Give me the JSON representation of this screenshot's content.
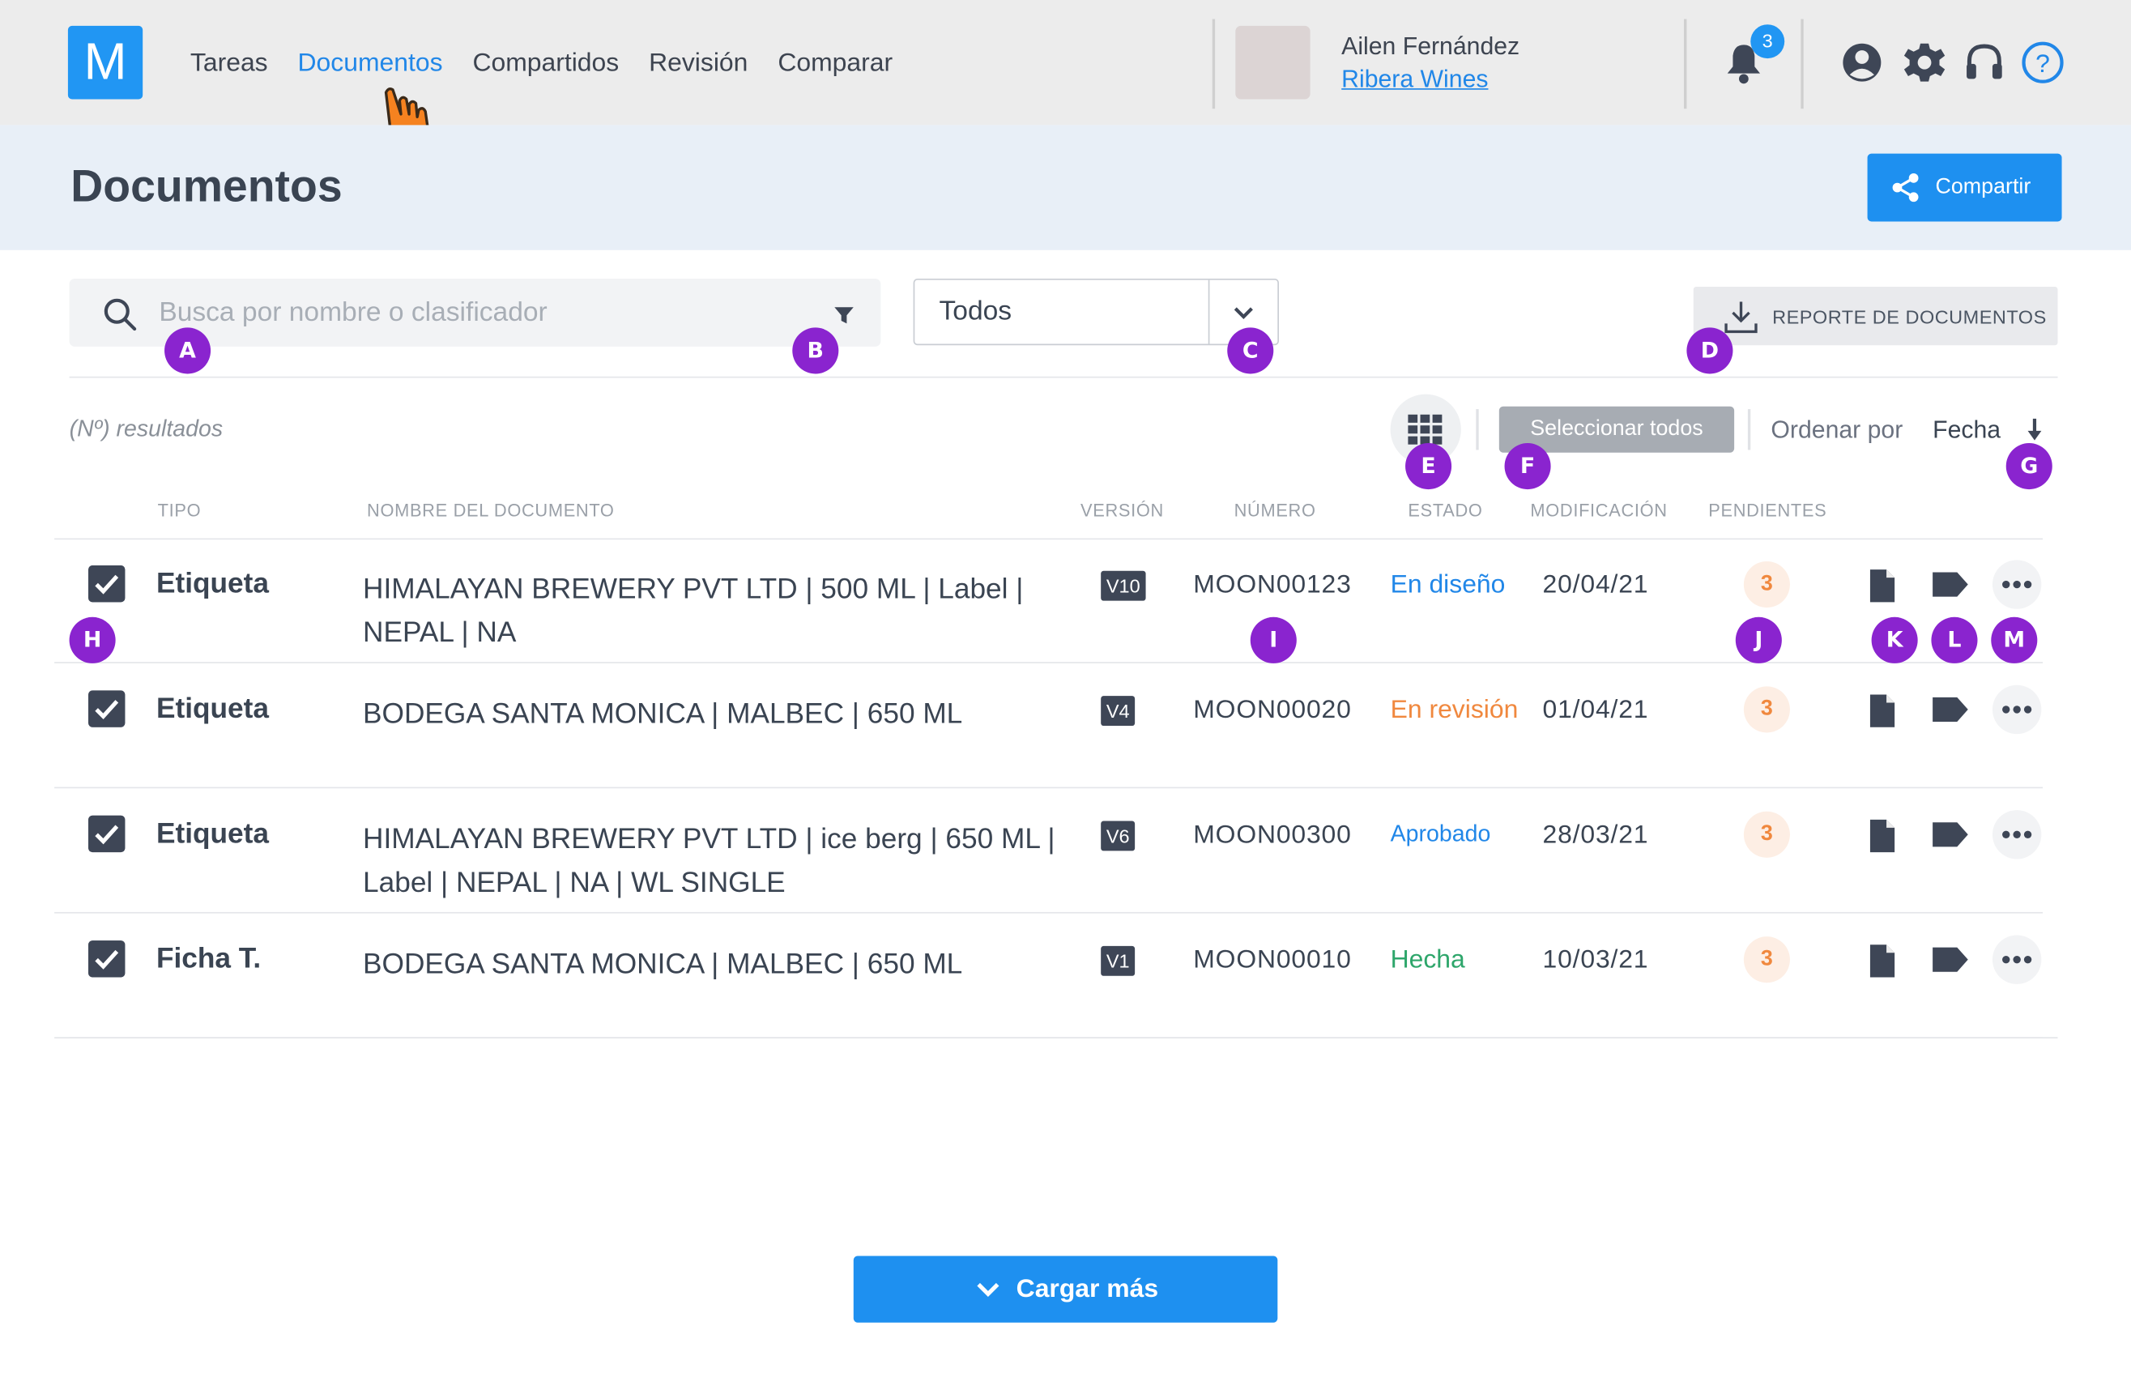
{
  "app": {
    "logo_letter": "M"
  },
  "nav": {
    "items": [
      {
        "label": "Tareas"
      },
      {
        "label": "Documentos"
      },
      {
        "label": "Compartidos"
      },
      {
        "label": "Revisión"
      },
      {
        "label": "Comparar"
      }
    ],
    "active": "Documentos"
  },
  "user": {
    "name": "Ailen Fernández",
    "company": "Ribera Wines"
  },
  "notifications": {
    "count": "3"
  },
  "page": {
    "title": "Documentos"
  },
  "share_button": {
    "label": "Compartir"
  },
  "search": {
    "placeholder": "Busca por nombre o clasificador",
    "value": ""
  },
  "filter_select": {
    "value": "Todos"
  },
  "report_button": {
    "label": "REPORTE DE DOCUMENTOS"
  },
  "results": {
    "text": "(Nº) resultados"
  },
  "select_all": {
    "label": "Seleccionar todos"
  },
  "order": {
    "label": "Ordenar por",
    "value": "Fecha"
  },
  "table": {
    "headers": [
      "TIPO",
      "NOMBRE DEL DOCUMENTO",
      "VERSIÓN",
      "NÚMERO",
      "ESTADO",
      "MODIFICACIÓN",
      "PENDIENTES"
    ],
    "rows": [
      {
        "tipo": "Etiqueta",
        "nombre": "HIMALAYAN BREWERY PVT LTD | 500 ML | Label | NEPAL | NA",
        "version": "V10",
        "numero": "MOON00123",
        "estado": "En diseño",
        "estado_color": "#2187e8",
        "modificacion": "20/04/21",
        "pendientes": "3"
      },
      {
        "tipo": "Etiqueta",
        "nombre": "BODEGA SANTA MONICA | MALBEC | 650 ML",
        "version": "V4",
        "numero": "MOON00020",
        "estado": "En revisión",
        "estado_color": "#f0883e",
        "modificacion": "01/04/21",
        "pendientes": "3"
      },
      {
        "tipo": "Etiqueta",
        "nombre": "HIMALAYAN BREWERY PVT LTD | ice berg | 650 ML | Label | NEPAL | NA | WL SINGLE",
        "version": "V6",
        "numero": "MOON00300",
        "estado": "Aprobado",
        "estado_color": "#2187e8",
        "modificacion": "28/03/21",
        "pendientes": "3"
      },
      {
        "tipo": "Ficha T.",
        "nombre": "BODEGA SANTA MONICA | MALBEC | 650 ML",
        "version": "V1",
        "numero": "MOON00010",
        "estado": "Hecha",
        "estado_color": "#2ea66b",
        "modificacion": "10/03/21",
        "pendientes": "3"
      }
    ]
  },
  "markers": [
    "A",
    "B",
    "C",
    "D",
    "E",
    "F",
    "G",
    "H",
    "I",
    "J",
    "K",
    "L",
    "M"
  ],
  "load_more": {
    "label": "Cargar más"
  },
  "colors": {
    "accent": "#1e90f0",
    "marker": "#8a24cf",
    "dark": "#3e4656"
  }
}
